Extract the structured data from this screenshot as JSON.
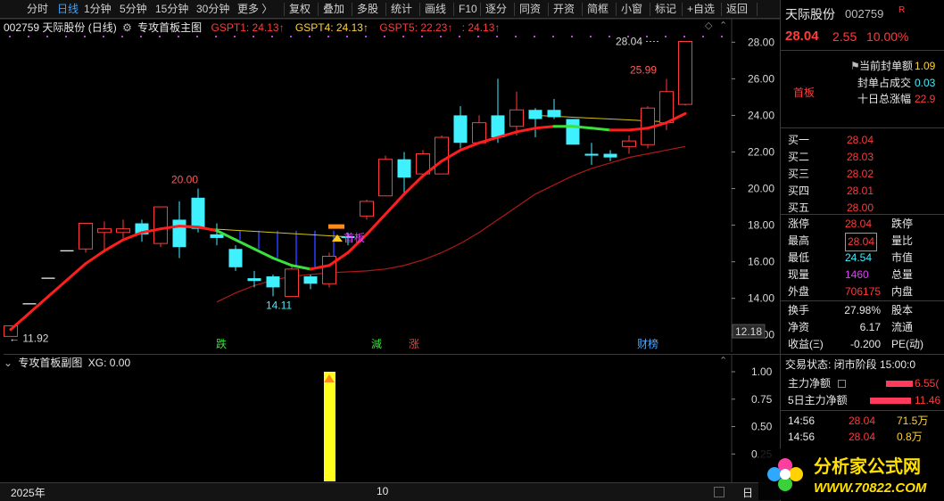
{
  "toolbar": {
    "items": [
      "分时",
      "日线",
      "1分钟",
      "5分钟",
      "15分钟",
      "30分钟",
      "更多 〉",
      "复权",
      "叠加",
      "多股",
      "统计",
      "画线",
      "F10",
      "逐分",
      "同资",
      "开资",
      "简框",
      "小窗",
      "标记",
      "+自选",
      "返回"
    ],
    "active_index": 1
  },
  "main_chart": {
    "stock_label": "002759 天际股份 (日线)",
    "indicator_name": "专攻首板主图",
    "gspt1": "GSPT1: 24.13↑",
    "gspt4": "GSPT4: 24.13↑",
    "gspt5": "GSPT5: 22.23↑",
    "extra": ": 24.13↑"
  },
  "sub_chart": {
    "indicator_name": "专攻首板副图",
    "xg": "XG: 0.00",
    "y_ticks": [
      "1.00",
      "0.75",
      "0.50",
      "0.25"
    ]
  },
  "price_axis": {
    "ticks": [
      "28.00",
      "26.00",
      "24.00",
      "22.00",
      "20.00",
      "18.00",
      "16.00",
      "14.00",
      "12.00"
    ],
    "current_price_tag": "12.18"
  },
  "annotations": {
    "high_label": "28.04",
    "label_2599": "25.99",
    "label_2000": "20.00",
    "label_1411": "14.11",
    "label_1192": "← 11.92",
    "event_die": "跌",
    "event_jian": "減",
    "event_zhang": "涨",
    "event_caibang": "财榜",
    "marker_text": "首板"
  },
  "date_axis": {
    "year_label": "2025年",
    "month_label": "10",
    "right_label": "日"
  },
  "quote_panel": {
    "name": "天际股份",
    "code": "002759",
    "badge": "R",
    "price": "28.04",
    "change": "2.55",
    "change_pct": "10.00%",
    "tag": "首板",
    "sealed_amount_label": "当前封单额",
    "sealed_amount_value": "1.09",
    "seal_ratio_label": "封单占成交",
    "seal_ratio_value": "0.03",
    "ten_day_label": "十日总涨幅",
    "ten_day_value": "22.9",
    "bids": [
      {
        "label": "买一",
        "price": "28.04"
      },
      {
        "label": "买二",
        "price": "28.03"
      },
      {
        "label": "买三",
        "price": "28.02"
      },
      {
        "label": "买四",
        "price": "28.01"
      },
      {
        "label": "买五",
        "price": "28.00"
      }
    ],
    "stats": [
      {
        "l1": "涨停",
        "v1": "28.04",
        "c1": "red",
        "l2": "跌停"
      },
      {
        "l1": "最高",
        "v1": "28.04",
        "c1": "red",
        "l2": "量比"
      },
      {
        "l1": "最低",
        "v1": "24.54",
        "c1": "cyan",
        "l2": "市值"
      },
      {
        "l1": "现量",
        "v1": "1460",
        "c1": "magenta",
        "l2": "总量"
      },
      {
        "l1": "外盘",
        "v1": "706175",
        "c1": "red",
        "l2": "内盘"
      }
    ],
    "fundamentals": [
      {
        "l1": "换手",
        "v1": "27.98%",
        "l2": "股本"
      },
      {
        "l1": "净资",
        "v1": "6.17",
        "l2": "流通"
      },
      {
        "l1": "收益(Ξ)",
        "v1": "-0.200",
        "l2": "PE(动)"
      }
    ],
    "trade_status": "交易状态: 闭市阶段 15:00:0",
    "main_net_label": "主力净额",
    "main_net_value": "6.55(",
    "five_day_net_label": "5日主力净额",
    "five_day_net_value": "11.46",
    "ticks": [
      {
        "time": "14:56",
        "price": "28.04",
        "vol": "71.5万"
      },
      {
        "time": "14:56",
        "price": "28.04",
        "vol": "0.8万"
      }
    ]
  },
  "watermark": {
    "title": "分析家公式网",
    "url": "WWW.70822.COM"
  },
  "chart_data": {
    "type": "candlestick",
    "y_range": [
      11.5,
      28.6
    ],
    "candles": [
      {
        "o": 11.92,
        "c": 12.5,
        "h": 12.5,
        "l": 11.92
      },
      {
        "o": 13.7,
        "c": 13.7,
        "h": 13.7,
        "l": 13.7
      },
      {
        "o": 15.1,
        "c": 15.1,
        "h": 15.1,
        "l": 15.1
      },
      {
        "o": 16.6,
        "c": 16.6,
        "h": 16.6,
        "l": 16.6
      },
      {
        "o": 16.7,
        "c": 18.1,
        "h": 18.1,
        "l": 16.5
      },
      {
        "o": 17.6,
        "c": 17.8,
        "h": 18.2,
        "l": 16.5
      },
      {
        "o": 17.6,
        "c": 17.8,
        "h": 18.3,
        "l": 17.3
      },
      {
        "o": 18.1,
        "c": 17.5,
        "h": 18.3,
        "l": 17.1
      },
      {
        "o": 17.0,
        "c": 19.0,
        "h": 19.0,
        "l": 16.8
      },
      {
        "o": 18.3,
        "c": 16.8,
        "h": 19.3,
        "l": 16.2
      },
      {
        "o": 19.5,
        "c": 17.8,
        "h": 20.0,
        "l": 17.6
      },
      {
        "o": 17.5,
        "c": 17.3,
        "h": 18.1,
        "l": 16.9
      },
      {
        "o": 16.7,
        "c": 15.7,
        "h": 16.9,
        "l": 15.5
      },
      {
        "o": 15.1,
        "c": 14.95,
        "h": 15.5,
        "l": 14.6
      },
      {
        "o": 15.2,
        "c": 14.6,
        "h": 15.3,
        "l": 14.11
      },
      {
        "o": 14.1,
        "c": 15.6,
        "h": 15.8,
        "l": 14.11
      },
      {
        "o": 15.2,
        "c": 14.8,
        "h": 15.3,
        "l": 14.5
      },
      {
        "o": 14.8,
        "c": 16.3,
        "h": 16.5,
        "l": 14.6
      },
      {
        "o": 17.4,
        "c": 17.3,
        "h": 17.6,
        "l": 16.9
      },
      {
        "o": 18.5,
        "c": 19.3,
        "h": 19.4,
        "l": 18.3
      },
      {
        "o": 19.6,
        "c": 21.6,
        "h": 21.8,
        "l": 19.6
      },
      {
        "o": 21.6,
        "c": 20.6,
        "h": 22.0,
        "l": 19.6
      },
      {
        "o": 20.8,
        "c": 21.9,
        "h": 22.1,
        "l": 20.8
      },
      {
        "o": 20.8,
        "c": 22.8,
        "h": 22.9,
        "l": 20.8
      },
      {
        "o": 24.0,
        "c": 22.5,
        "h": 24.5,
        "l": 22.2
      },
      {
        "o": 22.5,
        "c": 23.6,
        "h": 24.0,
        "l": 22.5
      },
      {
        "o": 24.0,
        "c": 22.8,
        "h": 26.0,
        "l": 22.5
      },
      {
        "o": 23.4,
        "c": 24.3,
        "h": 25.3,
        "l": 22.9
      },
      {
        "o": 24.3,
        "c": 23.8,
        "h": 24.4,
        "l": 22.8
      },
      {
        "o": 24.3,
        "c": 23.9,
        "h": 24.9,
        "l": 23.8
      },
      {
        "o": 23.8,
        "c": 22.4,
        "h": 23.8,
        "l": 22.4
      },
      {
        "o": 21.9,
        "c": 21.8,
        "h": 22.5,
        "l": 21.3
      },
      {
        "o": 21.9,
        "c": 21.7,
        "h": 22.1,
        "l": 21.5
      },
      {
        "o": 22.3,
        "c": 22.6,
        "h": 22.9,
        "l": 21.9
      },
      {
        "o": 22.4,
        "c": 24.4,
        "h": 24.5,
        "l": 22.2
      },
      {
        "o": 23.6,
        "c": 25.3,
        "h": 25.99,
        "l": 23.2
      },
      {
        "o": 24.6,
        "c": 28.04,
        "h": 28.04,
        "l": 24.54
      }
    ],
    "red_ma": [
      12.3,
      13.2,
      14.1,
      15.0,
      15.9,
      16.6,
      17.2,
      17.6,
      17.8,
      17.95,
      17.9,
      17.7,
      17.2,
      16.7,
      16.2,
      15.8,
      15.6,
      15.8,
      16.5,
      17.5,
      18.6,
      19.7,
      20.7,
      21.5,
      22.1,
      22.5,
      22.8,
      23.1,
      23.3,
      23.4,
      23.4,
      23.3,
      23.2,
      23.2,
      23.3,
      23.6,
      24.1
    ],
    "dark_ma": [
      null,
      null,
      null,
      null,
      null,
      null,
      null,
      null,
      null,
      null,
      null,
      13.8,
      14.3,
      14.7,
      15.0,
      15.2,
      15.3,
      15.4,
      15.45,
      15.5,
      15.6,
      15.8,
      16.1,
      16.5,
      17.0,
      17.6,
      18.3,
      19.0,
      19.7,
      20.2,
      20.7,
      21.1,
      21.4,
      21.7,
      21.9,
      22.1,
      22.3
    ],
    "sub_bar": {
      "index": 17,
      "value": 1.0
    }
  }
}
